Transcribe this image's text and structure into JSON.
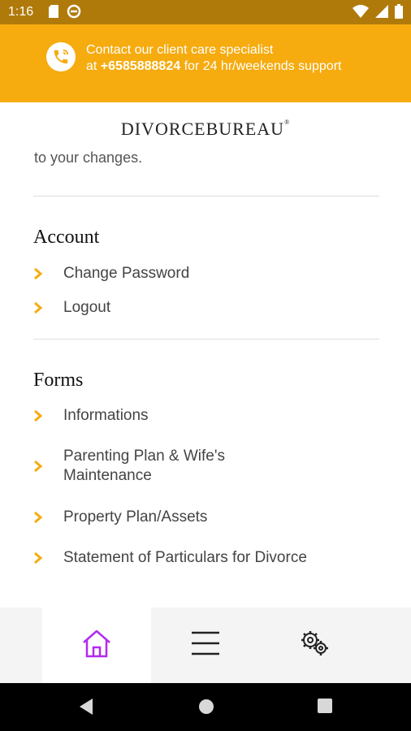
{
  "status_bar": {
    "time": "1:16"
  },
  "banner": {
    "line1": "Contact our client care specialist",
    "line2_prefix": "at ",
    "phone": "+6585888824",
    "line2_suffix": " for 24 hr/weekends support"
  },
  "logo": {
    "text": "DIVORCEBUREAU",
    "mark": "®"
  },
  "partial_text": "to your changes.",
  "account": {
    "title": "Account",
    "items": [
      {
        "label": "Change Password"
      },
      {
        "label": "Logout"
      }
    ]
  },
  "forms": {
    "title": "Forms",
    "items": [
      {
        "label": "Informations"
      },
      {
        "label": "Parenting Plan & Wife's Maintenance"
      },
      {
        "label": "Property Plan/Assets"
      },
      {
        "label": "Statement of Particulars for Divorce"
      }
    ]
  },
  "bottom_nav": {
    "tabs": [
      {
        "icon": "home-icon",
        "active": true
      },
      {
        "icon": "menu-icon",
        "active": false
      },
      {
        "icon": "settings-icon",
        "active": false
      }
    ]
  },
  "colors": {
    "accent": "#f6ab0f",
    "status_bar": "#b07a0b",
    "home_active": "#b329f0"
  }
}
